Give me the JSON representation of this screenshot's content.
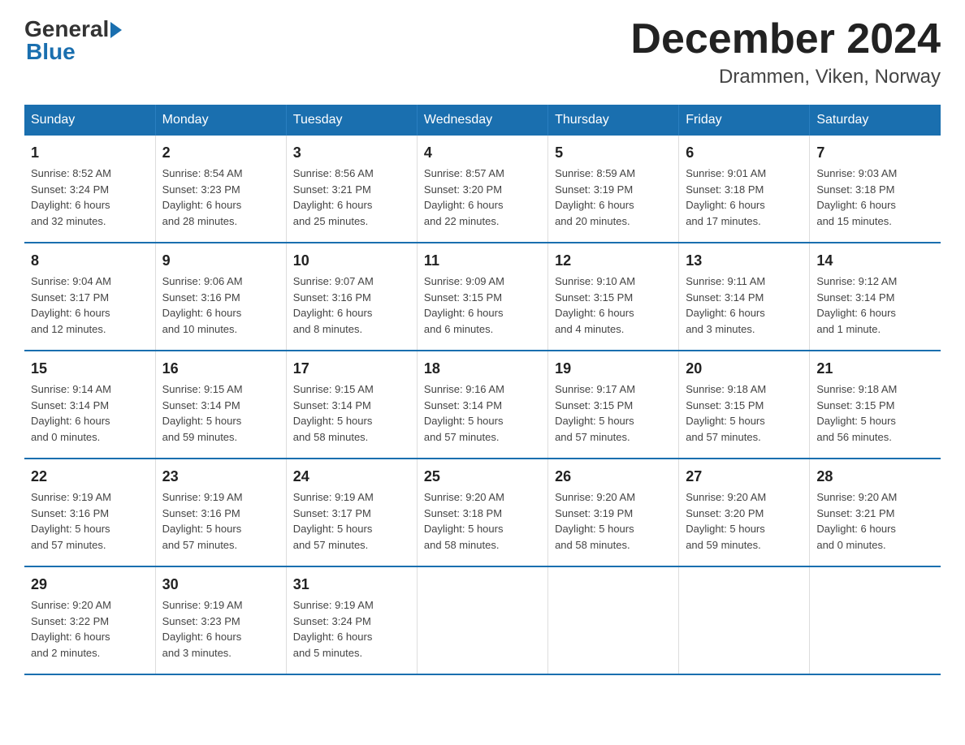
{
  "header": {
    "logo_general": "General",
    "logo_blue": "Blue",
    "month_title": "December 2024",
    "location": "Drammen, Viken, Norway"
  },
  "days_of_week": [
    "Sunday",
    "Monday",
    "Tuesday",
    "Wednesday",
    "Thursday",
    "Friday",
    "Saturday"
  ],
  "weeks": [
    [
      {
        "day": "1",
        "info": "Sunrise: 8:52 AM\nSunset: 3:24 PM\nDaylight: 6 hours\nand 32 minutes."
      },
      {
        "day": "2",
        "info": "Sunrise: 8:54 AM\nSunset: 3:23 PM\nDaylight: 6 hours\nand 28 minutes."
      },
      {
        "day": "3",
        "info": "Sunrise: 8:56 AM\nSunset: 3:21 PM\nDaylight: 6 hours\nand 25 minutes."
      },
      {
        "day": "4",
        "info": "Sunrise: 8:57 AM\nSunset: 3:20 PM\nDaylight: 6 hours\nand 22 minutes."
      },
      {
        "day": "5",
        "info": "Sunrise: 8:59 AM\nSunset: 3:19 PM\nDaylight: 6 hours\nand 20 minutes."
      },
      {
        "day": "6",
        "info": "Sunrise: 9:01 AM\nSunset: 3:18 PM\nDaylight: 6 hours\nand 17 minutes."
      },
      {
        "day": "7",
        "info": "Sunrise: 9:03 AM\nSunset: 3:18 PM\nDaylight: 6 hours\nand 15 minutes."
      }
    ],
    [
      {
        "day": "8",
        "info": "Sunrise: 9:04 AM\nSunset: 3:17 PM\nDaylight: 6 hours\nand 12 minutes."
      },
      {
        "day": "9",
        "info": "Sunrise: 9:06 AM\nSunset: 3:16 PM\nDaylight: 6 hours\nand 10 minutes."
      },
      {
        "day": "10",
        "info": "Sunrise: 9:07 AM\nSunset: 3:16 PM\nDaylight: 6 hours\nand 8 minutes."
      },
      {
        "day": "11",
        "info": "Sunrise: 9:09 AM\nSunset: 3:15 PM\nDaylight: 6 hours\nand 6 minutes."
      },
      {
        "day": "12",
        "info": "Sunrise: 9:10 AM\nSunset: 3:15 PM\nDaylight: 6 hours\nand 4 minutes."
      },
      {
        "day": "13",
        "info": "Sunrise: 9:11 AM\nSunset: 3:14 PM\nDaylight: 6 hours\nand 3 minutes."
      },
      {
        "day": "14",
        "info": "Sunrise: 9:12 AM\nSunset: 3:14 PM\nDaylight: 6 hours\nand 1 minute."
      }
    ],
    [
      {
        "day": "15",
        "info": "Sunrise: 9:14 AM\nSunset: 3:14 PM\nDaylight: 6 hours\nand 0 minutes."
      },
      {
        "day": "16",
        "info": "Sunrise: 9:15 AM\nSunset: 3:14 PM\nDaylight: 5 hours\nand 59 minutes."
      },
      {
        "day": "17",
        "info": "Sunrise: 9:15 AM\nSunset: 3:14 PM\nDaylight: 5 hours\nand 58 minutes."
      },
      {
        "day": "18",
        "info": "Sunrise: 9:16 AM\nSunset: 3:14 PM\nDaylight: 5 hours\nand 57 minutes."
      },
      {
        "day": "19",
        "info": "Sunrise: 9:17 AM\nSunset: 3:15 PM\nDaylight: 5 hours\nand 57 minutes."
      },
      {
        "day": "20",
        "info": "Sunrise: 9:18 AM\nSunset: 3:15 PM\nDaylight: 5 hours\nand 57 minutes."
      },
      {
        "day": "21",
        "info": "Sunrise: 9:18 AM\nSunset: 3:15 PM\nDaylight: 5 hours\nand 56 minutes."
      }
    ],
    [
      {
        "day": "22",
        "info": "Sunrise: 9:19 AM\nSunset: 3:16 PM\nDaylight: 5 hours\nand 57 minutes."
      },
      {
        "day": "23",
        "info": "Sunrise: 9:19 AM\nSunset: 3:16 PM\nDaylight: 5 hours\nand 57 minutes."
      },
      {
        "day": "24",
        "info": "Sunrise: 9:19 AM\nSunset: 3:17 PM\nDaylight: 5 hours\nand 57 minutes."
      },
      {
        "day": "25",
        "info": "Sunrise: 9:20 AM\nSunset: 3:18 PM\nDaylight: 5 hours\nand 58 minutes."
      },
      {
        "day": "26",
        "info": "Sunrise: 9:20 AM\nSunset: 3:19 PM\nDaylight: 5 hours\nand 58 minutes."
      },
      {
        "day": "27",
        "info": "Sunrise: 9:20 AM\nSunset: 3:20 PM\nDaylight: 5 hours\nand 59 minutes."
      },
      {
        "day": "28",
        "info": "Sunrise: 9:20 AM\nSunset: 3:21 PM\nDaylight: 6 hours\nand 0 minutes."
      }
    ],
    [
      {
        "day": "29",
        "info": "Sunrise: 9:20 AM\nSunset: 3:22 PM\nDaylight: 6 hours\nand 2 minutes."
      },
      {
        "day": "30",
        "info": "Sunrise: 9:19 AM\nSunset: 3:23 PM\nDaylight: 6 hours\nand 3 minutes."
      },
      {
        "day": "31",
        "info": "Sunrise: 9:19 AM\nSunset: 3:24 PM\nDaylight: 6 hours\nand 5 minutes."
      },
      {
        "day": "",
        "info": ""
      },
      {
        "day": "",
        "info": ""
      },
      {
        "day": "",
        "info": ""
      },
      {
        "day": "",
        "info": ""
      }
    ]
  ]
}
